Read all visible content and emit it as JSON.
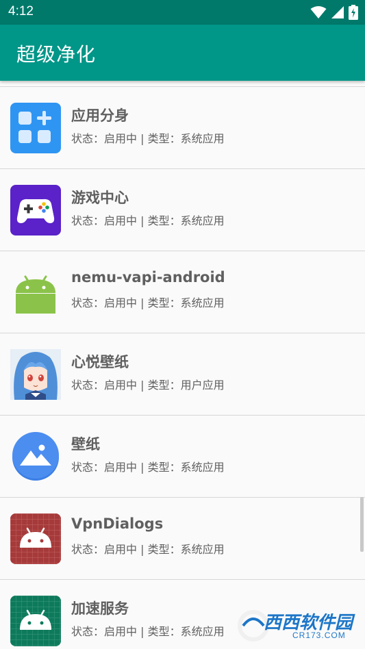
{
  "status_bar": {
    "time": "4:12",
    "icons": [
      "wifi-icon",
      "signal-icon",
      "battery-icon"
    ]
  },
  "app_bar": {
    "title": "超级净化",
    "color": "#009688"
  },
  "apps": [
    {
      "name": "应用分身",
      "status_text": "状态：启用中 | 类型：系统应用",
      "icon": "app-clone-icon"
    },
    {
      "name": "游戏中心",
      "status_text": "状态：启用中 | 类型：系统应用",
      "icon": "gamepad-icon"
    },
    {
      "name": "nemu-vapi-android",
      "status_text": "状态：启用中 | 类型：系统应用",
      "icon": "android-icon"
    },
    {
      "name": "心悦壁纸",
      "status_text": "状态：启用中 | 类型：用户应用",
      "icon": "anime-girl-icon"
    },
    {
      "name": "壁纸",
      "status_text": "状态：启用中 | 类型：系统应用",
      "icon": "wallpaper-icon"
    },
    {
      "name": "VpnDialogs",
      "status_text": "状态：启用中 | 类型：系统应用",
      "icon": "android-red-icon"
    },
    {
      "name": "加速服务",
      "status_text": "状态：启用中 | 类型：系统应用",
      "icon": "android-green-icon"
    }
  ],
  "watermark": {
    "text": "西西软件园",
    "sub": "CR173.COM"
  }
}
